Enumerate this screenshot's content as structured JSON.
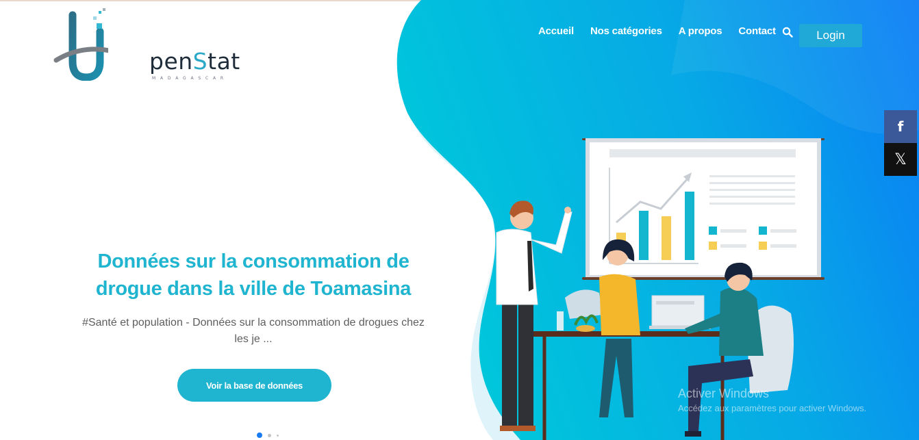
{
  "brand": {
    "name_prefix": "pen",
    "name_accent": "S",
    "name_suffix": "tat",
    "tagline": "MADAGASCAR"
  },
  "nav": {
    "items": [
      {
        "label": "Accueil"
      },
      {
        "label": "Nos catégories"
      },
      {
        "label": "A propos"
      },
      {
        "label": "Contact"
      }
    ],
    "login_label": "Login"
  },
  "share": {
    "facebook_glyph": "f",
    "x_glyph": "𝕏"
  },
  "hero": {
    "title": "Données sur la consommation de drogue dans la ville de Toamasina",
    "subtitle": "#Santé et population - Données sur la consommation de drogues chez les je ...",
    "cta_label": "Voir la base de données",
    "slides": {
      "count": 3,
      "active_index": 0
    }
  },
  "watermark": {
    "line1": "Activer Windows",
    "line2": "Accédez aux paramètres pour activer Windows."
  },
  "colors": {
    "accent": "#1fb4cf",
    "blob_start": "#00c2da",
    "blob_end": "#0a7ef5",
    "login_bg": "#20a8d6",
    "facebook": "#3b5998",
    "x": "#111111"
  },
  "icons": [
    "search-icon",
    "facebook-icon",
    "x-icon",
    "chart-board-illustration"
  ]
}
